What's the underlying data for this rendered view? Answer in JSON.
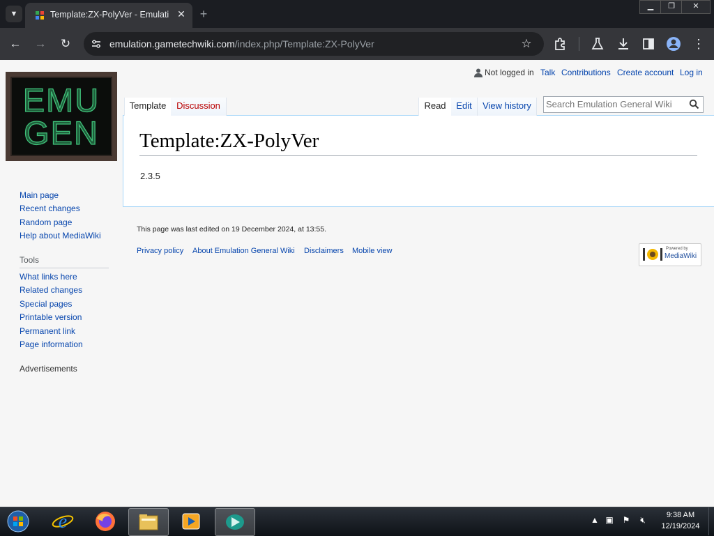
{
  "browser": {
    "tab_title": "Template:ZX-PolyVer - Emulati",
    "url_host": "emulation.gametechwiki.com",
    "url_path": "/index.php/Template:ZX-PolyVer",
    "icons": {
      "back": "back-arrow-icon",
      "forward": "forward-arrow-icon",
      "reload": "reload-icon",
      "bookmark": "star-icon",
      "extensions": "puzzle-icon",
      "labs": "flask-icon",
      "download": "download-icon",
      "side_panel": "side-panel-icon",
      "profile": "profile-icon",
      "menu": "kebab-menu-icon"
    }
  },
  "wiki": {
    "logo_text": "EMU GEN",
    "personal": {
      "not_logged_in": "Not logged in",
      "talk": "Talk",
      "contributions": "Contributions",
      "create_account": "Create account",
      "log_in": "Log in"
    },
    "namespaces": [
      "Template",
      "Discussion"
    ],
    "views": [
      "Read",
      "Edit",
      "View history"
    ],
    "search_placeholder": "Search Emulation General Wiki",
    "title": "Template:ZX-PolyVer",
    "content": "2.3.5",
    "navigation": [
      "Main page",
      "Recent changes",
      "Random page",
      "Help about MediaWiki"
    ],
    "tools_heading": "Tools",
    "tools": [
      "What links here",
      "Related changes",
      "Special pages",
      "Printable version",
      "Permanent link",
      "Page information"
    ],
    "advertisements": "Advertisements",
    "last_edited": "This page was last edited on 19 December 2024, at 13:55.",
    "footer_links": [
      "Privacy policy",
      "About Emulation General Wiki",
      "Disclaimers",
      "Mobile view"
    ],
    "powered_by": "Powered by",
    "mediawiki": "MediaWiki"
  },
  "taskbar": {
    "time": "9:38 AM",
    "date": "12/19/2024",
    "apps": [
      "start-orb-icon",
      "internet-explorer-icon",
      "firefox-icon",
      "file-explorer-icon",
      "media-player-icon",
      "browser-app-icon"
    ]
  },
  "colors": {
    "link": "#0645ad",
    "visited_link": "#ba0000",
    "chrome_dark": "#35363a",
    "logo_green": "#2e8b57"
  }
}
